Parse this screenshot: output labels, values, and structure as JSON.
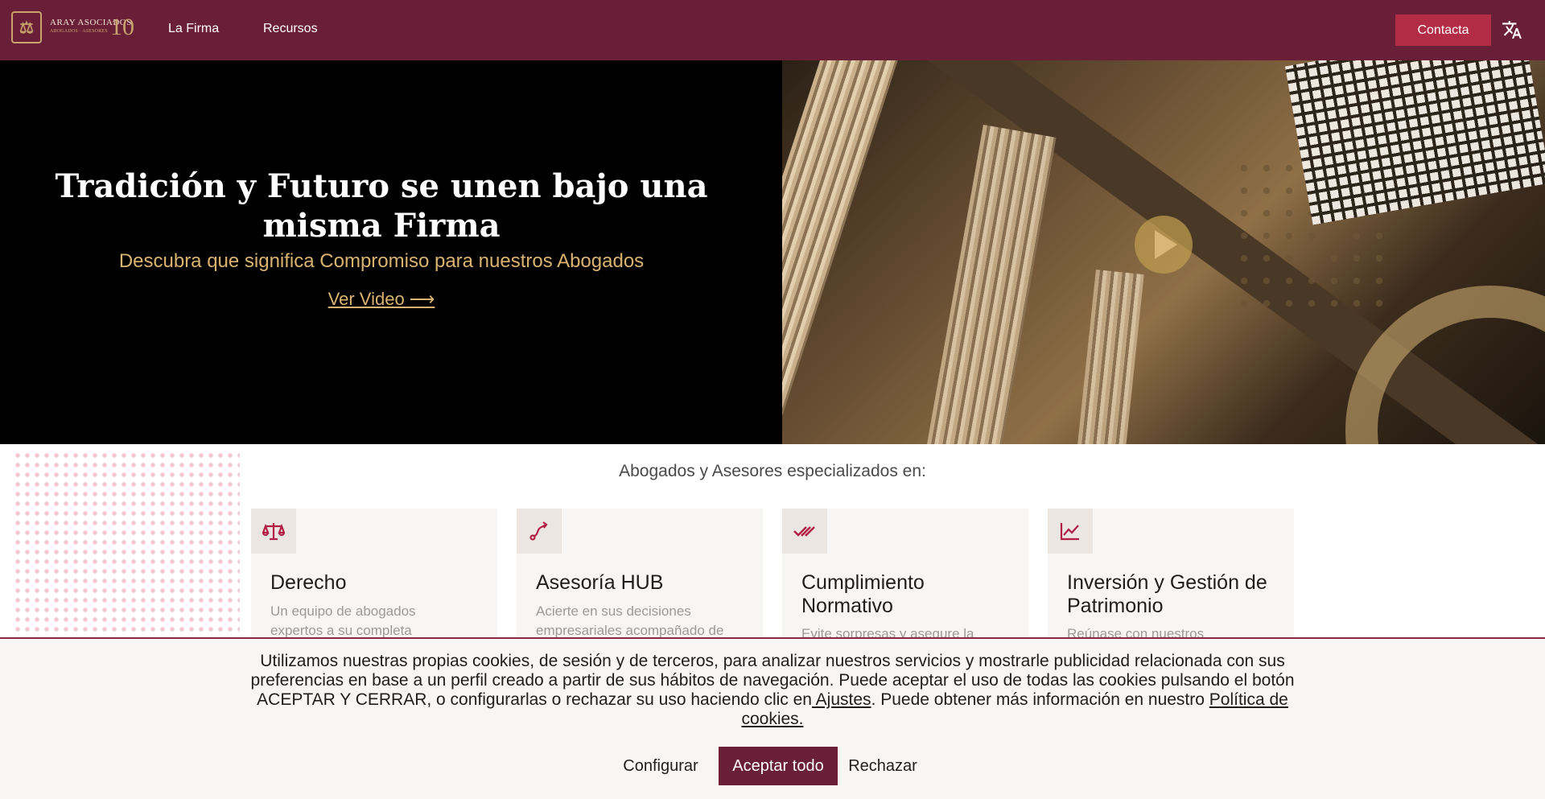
{
  "header": {
    "brand_name": "ARAY ASOCIADOS",
    "brand_sub": "ABOGADOS · ASESORES",
    "anniversary": "10",
    "nav": [
      {
        "label": "La Firma"
      },
      {
        "label": "Recursos"
      }
    ],
    "contact_label": "Contacta",
    "language_icon": "translate-icon"
  },
  "hero": {
    "title": "Tradición y Futuro se unen bajo una misma Firma",
    "subtitle": "Descubra que significa Compromiso para nuestros Abogados",
    "video_link": "Ver Video ⟶",
    "play_icon": "play-icon"
  },
  "services": {
    "heading": "Abogados y Asesores especializados en:",
    "cards": [
      {
        "icon": "scale-icon",
        "title": "Derecho",
        "description": "Un equipo de abogados expertos a su completa"
      },
      {
        "icon": "route-icon",
        "title": "Asesoría HUB",
        "description": "Acierte en sus decisiones empresariales acompañado de"
      },
      {
        "icon": "double-check-icon",
        "title": "Cumplimiento Normativo",
        "description": "Evite sorpresas y asegure la"
      },
      {
        "icon": "chart-line-icon",
        "title": "Inversión y Gestión de Patrimonio",
        "description": "Reúnase con nuestros"
      }
    ]
  },
  "cookie": {
    "text_main": "Utilizamos nuestras propias cookies, de sesión y de terceros, para analizar nuestros servicios y mostrarle publicidad relacionada con sus preferencias en base a un perfil creado a partir de sus hábitos de navegación. Puede aceptar el uso de todas las cookies pulsando el botón ACEPTAR Y CERRAR, o configurarlas o rechazar su uso haciendo clic en",
    "settings_link": " Ajustes",
    "text_mid": ". Puede obtener más información en nuestro ",
    "policy_link": "Política de cookies.",
    "configure_label": "Configurar",
    "accept_label": "Aceptar todo",
    "reject_label": "Rechazar"
  },
  "colors": {
    "brand": "#6a1f38",
    "accent": "#b22c45",
    "gold": "#d9b36f"
  }
}
